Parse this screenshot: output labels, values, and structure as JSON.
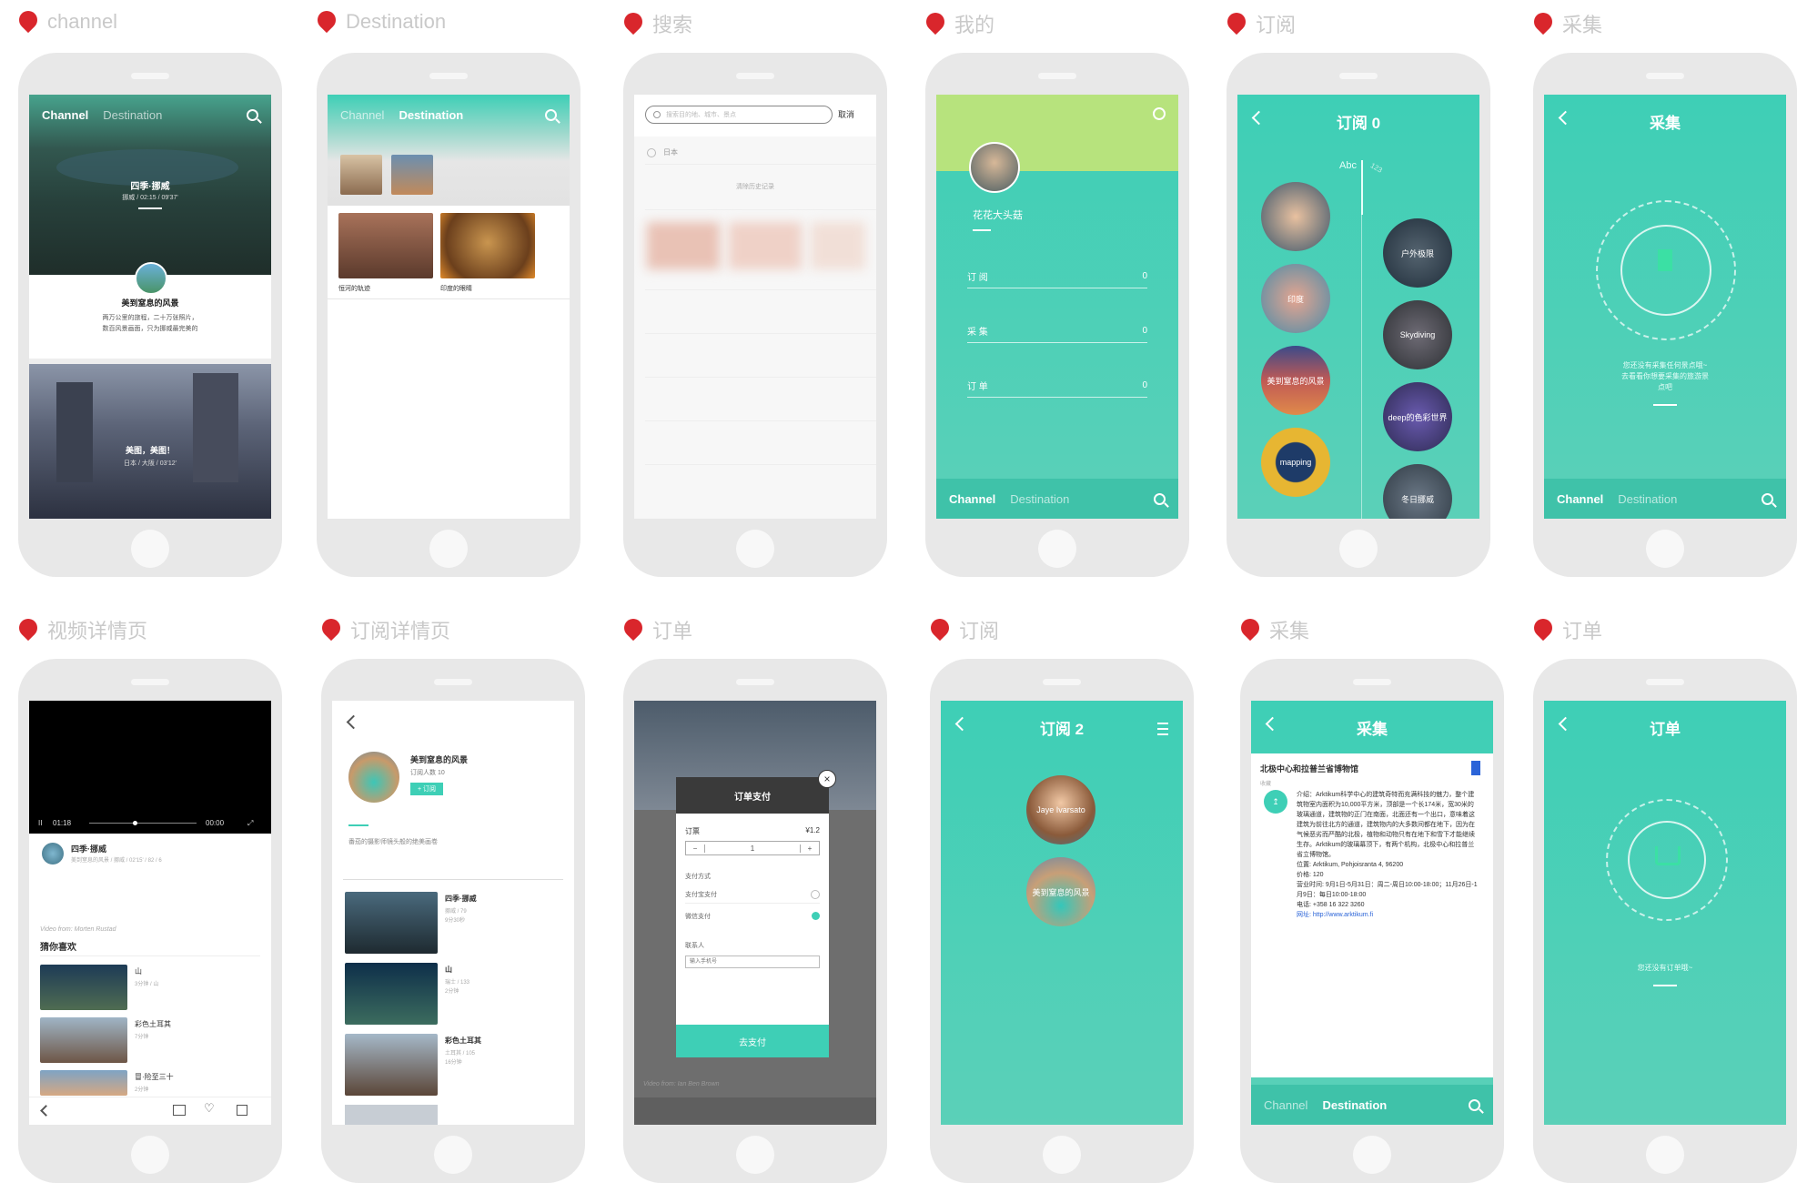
{
  "labels": [
    "channel",
    "Destination",
    "搜索",
    "我的",
    "订阅",
    "采集",
    "视频详情页",
    "订阅详情页",
    "订单",
    "订阅",
    "采集",
    "订单"
  ],
  "tabbar": {
    "channel": "Channel",
    "destination": "Destination"
  },
  "screen1": {
    "hero_title": "四季·挪威",
    "hero_meta": "挪威 / 02:15 / 09'37'",
    "card_title": "美到窒息的风景",
    "card_desc1": "两万公里的旅程，二十万张照片，",
    "card_desc2": "数百风景画面，只为挪威最完美的",
    "city_title": "美图，美图！",
    "city_meta": "日本 / 大阪 / 03'12'"
  },
  "screen2": {
    "cap1": "恒河的轨迹",
    "cap2": "印度的眼睛"
  },
  "screen3": {
    "search_placeholder": "搜索目的地、城市、景点",
    "cancel": "取消",
    "history_item": "日本",
    "clear_history": "清除历史记录"
  },
  "screen4": {
    "nickname": "花花大头菇",
    "rows": [
      {
        "label": "订 阅",
        "value": "0"
      },
      {
        "label": "采 集",
        "value": "0"
      },
      {
        "label": "订 单",
        "value": "0"
      }
    ]
  },
  "screen5": {
    "title": "订阅 0",
    "col1": "Abc",
    "col2": "123",
    "circles_left": [
      "",
      "印度",
      "美到窒息的风景",
      "mapping"
    ],
    "circles_right": [
      "户外极限",
      "Skydiving",
      "deep的色彩世界",
      "冬日挪威"
    ]
  },
  "screen6": {
    "title": "采集",
    "empty_text1": "您还没有采集任何景点哦~",
    "empty_text2": "去看看你想要采集的旅游景",
    "empty_text3": "点吧"
  },
  "screen7": {
    "time_current": "01:18",
    "time_total": "00:00",
    "video_title": "四季·挪威",
    "video_meta": "美到窒息的风景 / 挪威 / 02'15' / 82 / 6",
    "video_from": "Video from: Morten Rustad",
    "guess_title": "猜你喜欢",
    "recs": [
      {
        "title": "山",
        "meta": "3分钟 / 山"
      },
      {
        "title": "彩色土耳其",
        "meta": "7分钟"
      },
      {
        "title": "冒·险至三十",
        "meta": "2分钟"
      }
    ]
  },
  "screen8": {
    "title": "美到窒息的风景",
    "subs": "订阅人数 10",
    "sub_btn": "+ 订阅",
    "desc": "番茄的摄影师镜头般的绝美画卷",
    "items": [
      {
        "title": "四季·挪威",
        "meta1": "挪威 / 79",
        "meta2": "9分30秒"
      },
      {
        "title": "山",
        "meta1": "瑞士 / 133",
        "meta2": "2分钟"
      },
      {
        "title": "彩色土耳其",
        "meta1": "土耳其 / 105",
        "meta2": "16分钟"
      }
    ]
  },
  "screen9": {
    "modal_title": "订单支付",
    "item": "订票",
    "price": "¥1.2",
    "qty": "1",
    "pay_method": "支付方式",
    "alipay": "支付宝支付",
    "wechat": "微信支付",
    "contact": "联系人",
    "phone_ph": "输入手机号",
    "pay_btn": "去支付",
    "video_from": "Video from: Ian Ben Brown"
  },
  "screen10": {
    "title": "订阅 2",
    "circle1": "Jaye Ivarsato",
    "circle2": "美到窒息的风景"
  },
  "screen11": {
    "title": "采集",
    "place": "北极中心和拉普兰省博物馆",
    "tag": "收藏",
    "intro": "介绍：Arktikum科学中心的建筑奇特而充满科技的魅力，整个建筑物室内面积为10,000平方米，顶部是一个长174米，宽30米的玻璃通道，建筑物的正门在南面，北面还有一个出口，意味着这建筑为前往北方的通道，建筑物内的大多数间都在地下，因为在气候恶劣而严酷的北极，植物和动物只有在地下和雪下才能继续生存。Arktikum的玻璃幕顶下，有两个机构，北极中心和拉普兰省立博物馆。",
    "location": "位置: Arktikum, Pohjoisranta 4, 96200",
    "ticket": "价格: 120",
    "hours": "营业时间: 9月1日-5月31日：周二-周日10:00-18:00；11月26日-1月9日：每日10:00-18:00",
    "tel": "电话: +358 16 322 3260",
    "web": "网址: http://www.arktikum.fi"
  },
  "screen12": {
    "title": "订单",
    "empty": "您还没有订单哦~"
  }
}
